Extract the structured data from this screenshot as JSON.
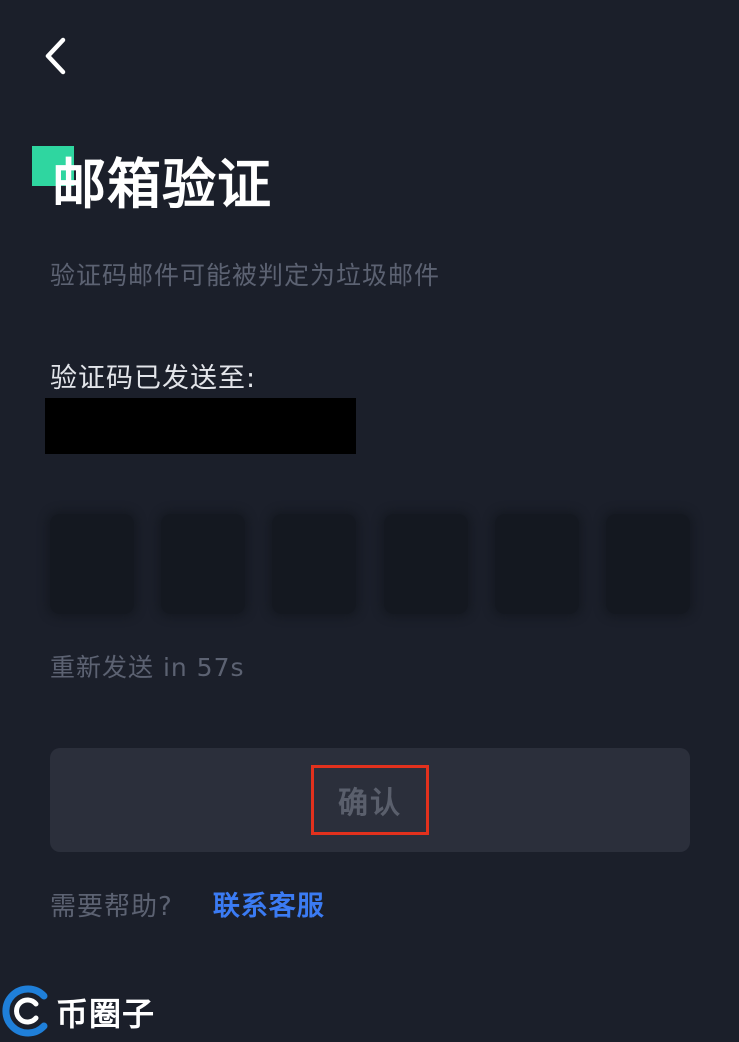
{
  "header": {
    "back_icon": "chevron-left-icon",
    "title": "邮箱验证",
    "accent_color": "#2fd6a0"
  },
  "subtitle": "验证码邮件可能被判定为垃圾邮件",
  "sent_label": "验证码已发送至:",
  "code_inputs": [
    "",
    "",
    "",
    "",
    "",
    ""
  ],
  "resend": "重新发送 in 57s",
  "confirm": {
    "label": "确认",
    "highlight_color": "#e2311d"
  },
  "help": {
    "text": "需要帮助?",
    "link": "联系客服",
    "link_color": "#3b7bf3"
  },
  "watermark": {
    "text": "币圈子",
    "icon": "c-logo-icon"
  }
}
